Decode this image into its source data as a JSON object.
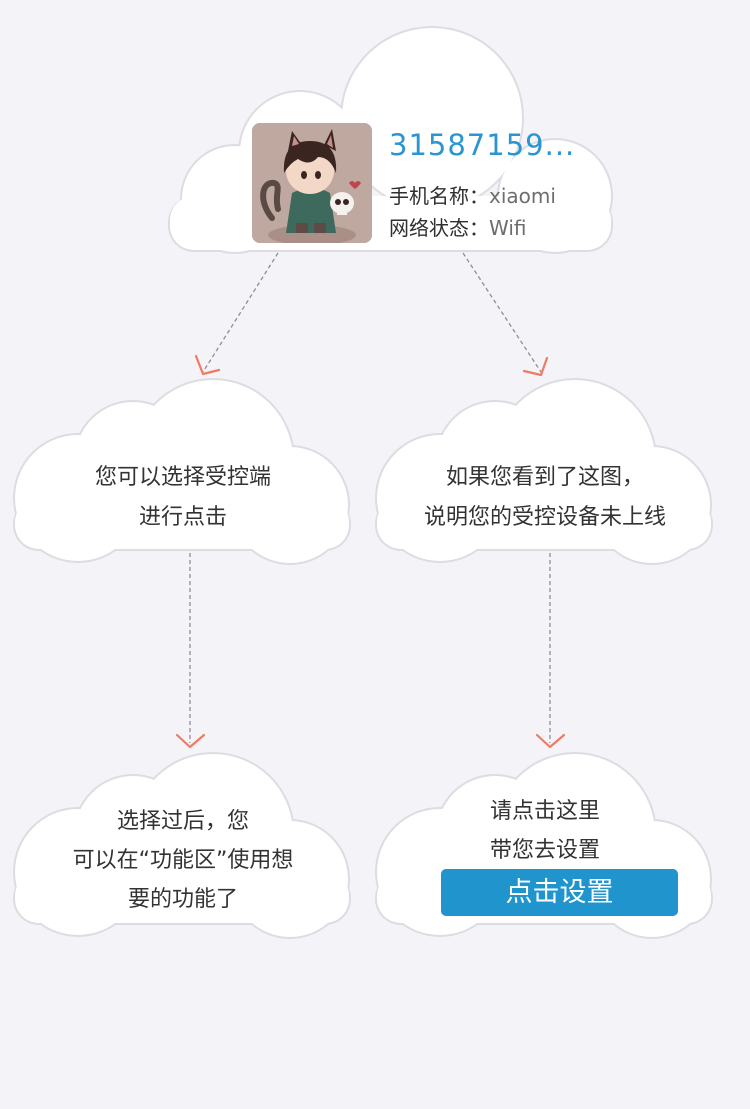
{
  "device": {
    "name": "31587159...",
    "phone_name_label": "手机名称：",
    "phone_name_value": "xiaomi",
    "network_label": "网络状态：",
    "network_value": "Wifi"
  },
  "clouds": {
    "select_hint": [
      "您可以选择受控端",
      "进行点击"
    ],
    "offline_hint": [
      "如果您看到了这图，",
      "说明您的受控设备未上线"
    ],
    "after_select_hint": [
      "选择过后，您",
      "可以在“功能区”使用想",
      "要的功能了"
    ],
    "settings_hint": [
      "请点击这里",
      "带您去设置"
    ]
  },
  "setup_button": {
    "label": "点击设置"
  },
  "colors": {
    "background": "#f4f3f8",
    "accent": "#1f94cd",
    "arrow": "#f07b64",
    "cloud_fill": "#ffffff",
    "cloud_stroke": "#dcdce2"
  },
  "icons": {
    "avatar": "anime-cat-boy-holding-skull",
    "arrow_head": "chevron-down"
  }
}
